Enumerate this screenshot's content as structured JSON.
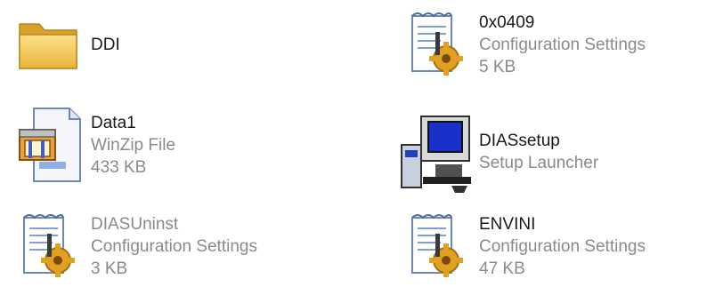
{
  "files": [
    {
      "name": "DDI",
      "type": "",
      "size": "",
      "icon": "folder-icon"
    },
    {
      "name": "0x0409",
      "type": "Configuration Settings",
      "size": "5 KB",
      "icon": "config-settings-icon"
    },
    {
      "name": "Data1",
      "type": "WinZip File",
      "size": "433 KB",
      "icon": "winzip-file-icon"
    },
    {
      "name": "DIASsetup",
      "type": "Setup Launcher",
      "size": "",
      "icon": "setup-launcher-icon"
    },
    {
      "name": "DIASUninst",
      "type": "Configuration Settings",
      "size": "3 KB",
      "icon": "config-settings-icon"
    },
    {
      "name": "ENVINI",
      "type": "Configuration Settings",
      "size": "47 KB",
      "icon": "config-settings-icon"
    }
  ],
  "colors": {
    "folder": "#f2c84b",
    "gear": "#e0a020",
    "text_primary": "#1a1a1a",
    "text_secondary": "#8a8a8a"
  }
}
